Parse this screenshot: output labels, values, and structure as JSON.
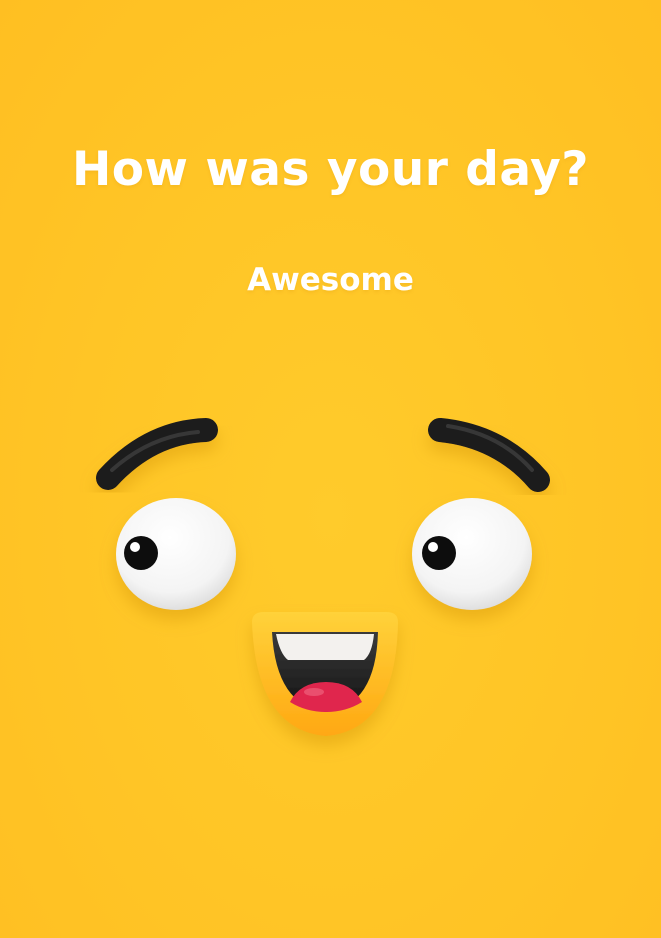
{
  "prompt": {
    "question": "How was your day?",
    "selected_mood": "Awesome"
  },
  "face": {
    "icon": "happy-face-icon",
    "background_color": "#ffc526",
    "eyebrow_color": "#1c1c1c",
    "eye_color": "#ffffff",
    "pupil_color": "#111111",
    "mouth_rim_color": "#ffb21a",
    "tongue_color": "#e0284e"
  }
}
